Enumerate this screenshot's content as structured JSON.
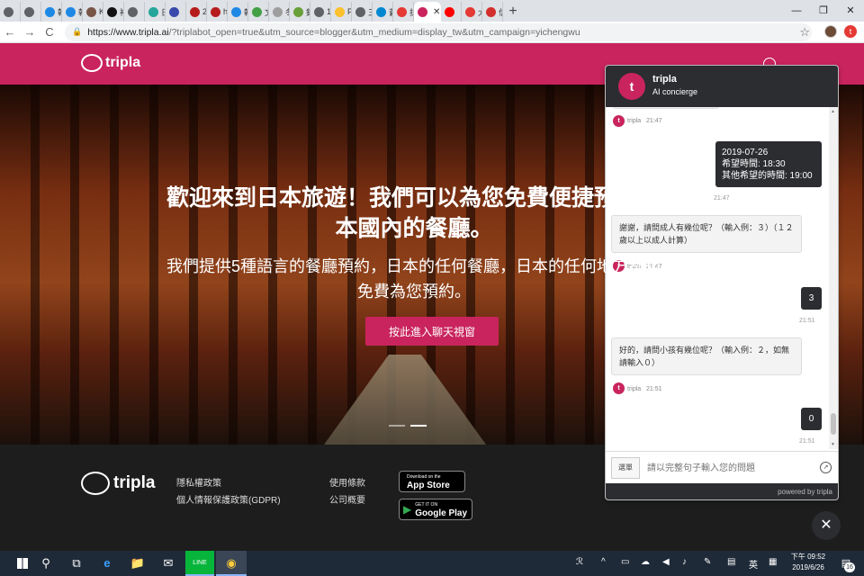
{
  "browser": {
    "tabs": [
      {
        "label": "",
        "color": "#5f6368"
      },
      {
        "label": "【",
        "color": "#5f6368"
      },
      {
        "label": "韓",
        "color": "#1e88e5"
      },
      {
        "label": "韓",
        "color": "#1e88e5"
      },
      {
        "label": "K",
        "color": "#795548"
      },
      {
        "label": "裕",
        "color": "#111111"
      },
      {
        "label": "【",
        "color": "#5f6368"
      },
      {
        "label": "日",
        "color": "#26a69a"
      },
      {
        "label": "",
        "color": "#3949ab"
      },
      {
        "label": "2(",
        "color": "#b71c1c"
      },
      {
        "label": "h",
        "color": "#b71c1c"
      },
      {
        "label": "韓",
        "color": "#1e88e5"
      },
      {
        "label": "文",
        "color": "#43a047"
      },
      {
        "label": "冬",
        "color": "#9e9e9e"
      },
      {
        "label": "鈴",
        "color": "#689f38"
      },
      {
        "label": "1(",
        "color": "#5f6368"
      },
      {
        "label": "P(",
        "color": "#fbc02d"
      },
      {
        "label": "三",
        "color": "#5f6368"
      },
      {
        "label": "蒼",
        "color": "#0288d1"
      },
      {
        "label": "折",
        "color": "#e53935"
      }
    ],
    "active_tab": {
      "label": "",
      "color": "#c9245d"
    },
    "tabs_after": [
      {
        "label": "",
        "color": "#ff0000"
      },
      {
        "label": "大",
        "color": "#e53935"
      },
      {
        "label": "信",
        "color": "#d32f2f"
      }
    ],
    "new_tab": "+",
    "window_controls": {
      "minimize": "—",
      "maximize": "❐",
      "close": "✕"
    },
    "nav": {
      "back": "←",
      "forward": "→",
      "reload": "C"
    },
    "url_host": "https://www.tripla.ai",
    "url_rest": "/?triplabot_open=true&utm_source=blogger&utm_medium=display_tw&utm_campaign=yichengwu",
    "star": "☆",
    "ext_label": "t"
  },
  "site": {
    "logo_text": "tripla",
    "hero_title": "歡迎來到日本旅遊！我們可以為您免費便捷預約日本國內的餐廳。",
    "hero_sub": "我們提供5種語言的餐廳預約，日本的任何餐廳，日本的任何地方都可免費為您預約。",
    "hero_button": "按此進入聊天視窗",
    "footer": {
      "logo_text": "tripla",
      "links_col1": [
        "隱私權政策",
        "個人情報保護政策(GDPR)"
      ],
      "links_col2": [
        "使用條款",
        "公司概要"
      ],
      "app_store": {
        "small": "Download on the",
        "big": "App Store",
        "icon": ""
      },
      "google_play": {
        "small": "GET IT ON",
        "big": "Google Play",
        "icon": "▶"
      }
    }
  },
  "chat": {
    "name": "tripla",
    "role": "AI concierge",
    "avatar": "t",
    "messages": [
      {
        "type": "meta",
        "sender": "tripla",
        "time": "21:47"
      },
      {
        "type": "out",
        "lines": [
          "2019-07-26",
          "希望時間: 18:30",
          "其他希望的時間: 19:00"
        ],
        "time": "21:47"
      },
      {
        "type": "in",
        "text": "謝謝，請問成人有幾位呢？（輸入例：３）（１２歲以上以成人計算）"
      },
      {
        "type": "meta",
        "sender": "tripla",
        "time": "21:47"
      },
      {
        "type": "out",
        "lines": [
          "3"
        ],
        "time": "21:51"
      },
      {
        "type": "in",
        "text": "好的，請問小孩有幾位呢？（輸入例：２，如無請輸入０）"
      },
      {
        "type": "meta",
        "sender": "tripla",
        "time": "21:51"
      },
      {
        "type": "out",
        "lines": [
          "0"
        ],
        "time": "21:51"
      }
    ],
    "menu_button": "選單",
    "input_placeholder": "請以完整句子輸入您的問題",
    "send_icon": "↗",
    "powered_by": "powered by  tripla",
    "close": "✕"
  },
  "taskbar": {
    "search_icon": "⚲",
    "taskview_icon": "⧉",
    "apps": [
      "e",
      "📁",
      "✉",
      "LINE",
      "◉"
    ],
    "tray": [
      "ℛ",
      "^",
      "▭",
      "☁",
      "◀",
      "♪",
      "✎",
      "▤",
      "英",
      "▦"
    ],
    "clock_time": "下午 09:52",
    "clock_date": "2019/6/26",
    "notification_count": "16"
  }
}
